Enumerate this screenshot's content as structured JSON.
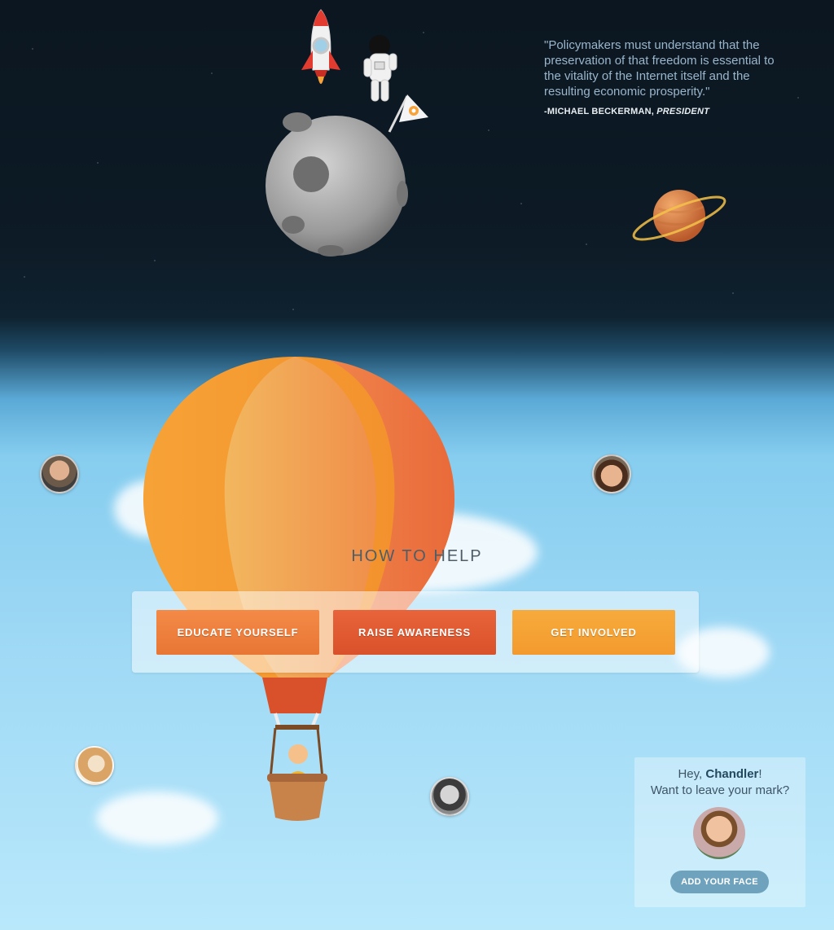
{
  "quote": {
    "text": "\"Policymakers must understand that the preservation of that freedom is essential to the vitality of the Internet itself and the resulting economic prosperity.\"",
    "author": "-MICHAEL BECKERMAN,",
    "role": "PRESIDENT"
  },
  "how_to_help": {
    "title": "HOW TO HELP",
    "buttons": {
      "educate": "EDUCATE YOURSELF",
      "raise": "RAISE AWARENESS",
      "involved": "GET INVOLVED"
    }
  },
  "mark_card": {
    "greeting": "Hey,",
    "name": "Chandler",
    "exclaim": "!",
    "prompt": "Want to leave your mark?",
    "button": "ADD YOUR FACE"
  },
  "colors": {
    "space": "#0d1b26",
    "sky": "#86cdef",
    "accent_orange": "#f48a47",
    "accent_red": "#d9512a",
    "accent_yellow": "#f7ab3c",
    "button_blue": "#6fa3bd"
  }
}
